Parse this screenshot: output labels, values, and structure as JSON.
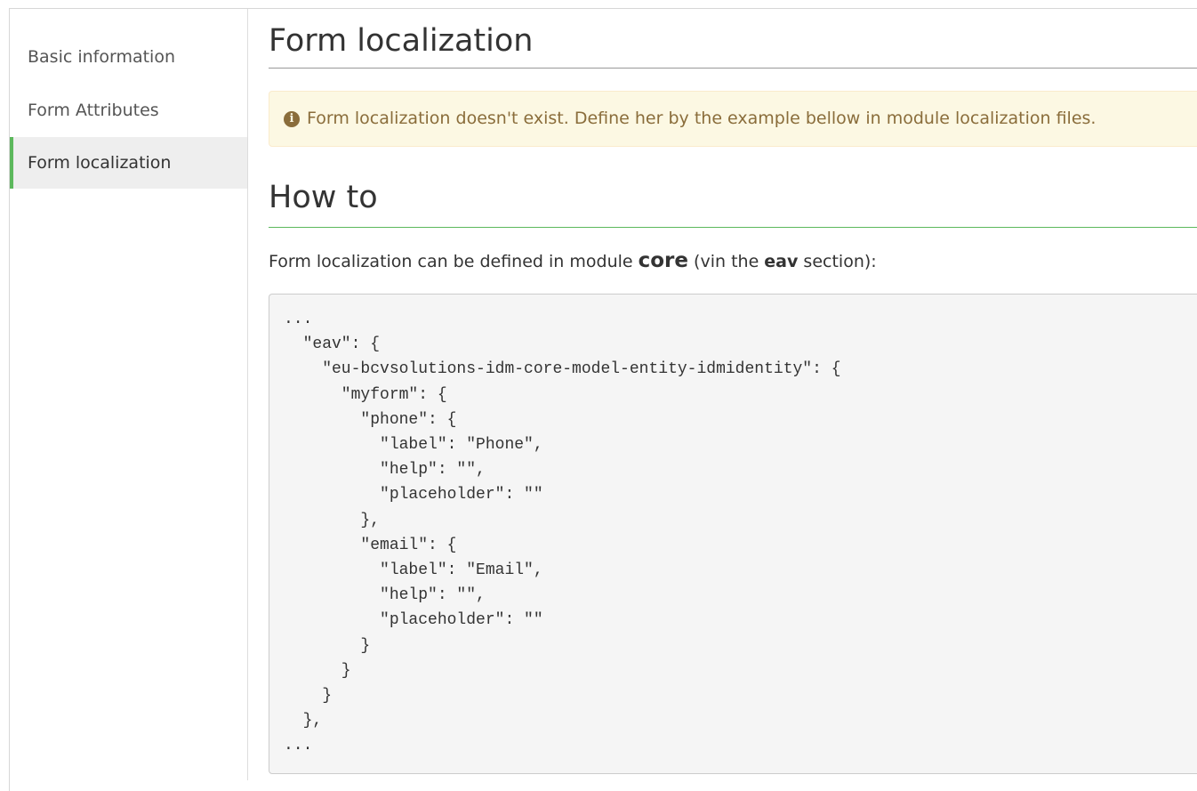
{
  "sidebar": {
    "items": [
      {
        "label": "Basic information",
        "active": false
      },
      {
        "label": "Form Attributes",
        "active": false
      },
      {
        "label": "Form localization",
        "active": true
      }
    ]
  },
  "main": {
    "title": "Form localization",
    "alert": {
      "icon": "info-circle-icon",
      "text": "Form localization doesn't exist. Define her by the example bellow in module localization files."
    },
    "howto": {
      "title": "How to",
      "desc_prefix": "Form localization can be defined in module ",
      "module": "core",
      "desc_middle": " (vin the ",
      "section": "eav",
      "desc_suffix": " section):",
      "code": "...\n  \"eav\": {\n    \"eu-bcvsolutions-idm-core-model-entity-idmidentity\": {\n      \"myform\": {\n        \"phone\": {\n          \"label\": \"Phone\",\n          \"help\": \"\",\n          \"placeholder\": \"\"\n        },\n        \"email\": {\n          \"label\": \"Email\",\n          \"help\": \"\",\n          \"placeholder\": \"\"\n        }\n      }\n    }\n  },\n..."
    }
  },
  "colors": {
    "active_accent": "#5cb85c",
    "alert_bg": "#fcf8e3",
    "alert_text": "#8a6d3b",
    "code_bg": "#f5f5f5"
  }
}
